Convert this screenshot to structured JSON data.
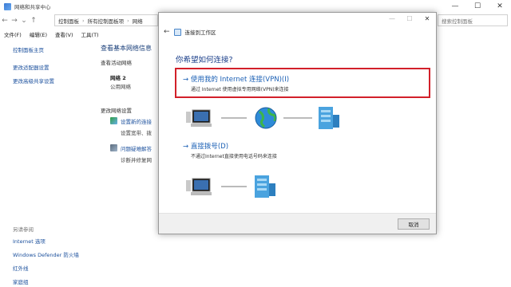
{
  "bg_window": {
    "title": "网络和共享中心",
    "breadcrumb": [
      "控制面板",
      "所有控制面板项",
      "网络"
    ],
    "search_placeholder": "搜索控制面板",
    "menu": [
      "文件(F)",
      "编辑(E)",
      "查看(V)",
      "工具(T)"
    ],
    "sidebar": [
      "控制面板主页",
      "更改适配器设置",
      "更改高级共享设置"
    ],
    "see_also": {
      "heading": "另请参阅",
      "items": [
        "Internet 选项",
        "Windows Defender 防火墙",
        "红外线",
        "家庭组"
      ]
    },
    "main_title": "查看基本网络信息",
    "active_networks_label": "查看活动网络",
    "network_name": "网络 2",
    "network_type": "公用网络",
    "change_settings_label": "更改网络设置",
    "tasks": [
      {
        "link": "设置新的连接",
        "desc": "设置宽带、拨"
      },
      {
        "link": "问题疑难解答",
        "desc": "诊断并修复网"
      }
    ]
  },
  "dialog": {
    "title": "连接到工作区",
    "question": "你希望如何连接?",
    "options": [
      {
        "title": "使用我的 Internet 连接(VPN)(I)",
        "desc": "通过 Internet 使用虚拟专用网络(VPN)来连接"
      },
      {
        "title": "直接拨号(D)",
        "desc": "不通过Internet直接使用电话号码来连接"
      }
    ],
    "cancel_label": "取消"
  },
  "colors": {
    "link": "#1a5fb4",
    "highlight_border": "#d2202a",
    "question_text": "#1b3f8a"
  }
}
